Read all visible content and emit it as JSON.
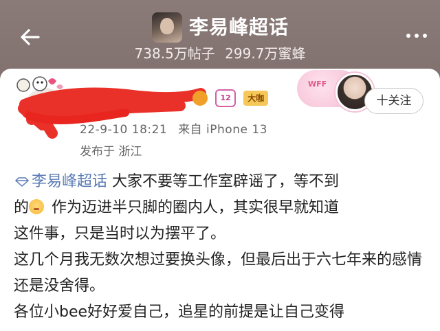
{
  "header": {
    "title": "李易峰超话",
    "posts_count": "738.5万帖子",
    "members_count": "299.7万蜜蜂"
  },
  "post": {
    "timestamp": "22-9-10 18:21",
    "source": "来自 iPhone 13",
    "location": "发布于 浙江",
    "badge_level": "12",
    "badge_fan": "大咖",
    "follow_label": "十关注",
    "topic": "李易峰超话",
    "text_1a": "  大家不要等工作室辟谣了，等不到",
    "text_1b": "的",
    "text_1c": " 作为迈进半只脚的圈内人，其实很早就知道",
    "text_1d": "这件事，只是当时以为摆平了。",
    "text_2": "这几个月我无数次想过要换头像，但最后出于六七年来的感情还是没舍得。",
    "text_3": "各位小bee好好爱自己，追星的前提是让自己变得"
  },
  "icons": {
    "back": "back-arrow-icon",
    "more": "more-dots-icon",
    "topic": "diamond-icon",
    "emoji": "sad-face-emoji"
  },
  "colors": {
    "topic": "#5b7bb5",
    "scribble": "#e8261f"
  }
}
